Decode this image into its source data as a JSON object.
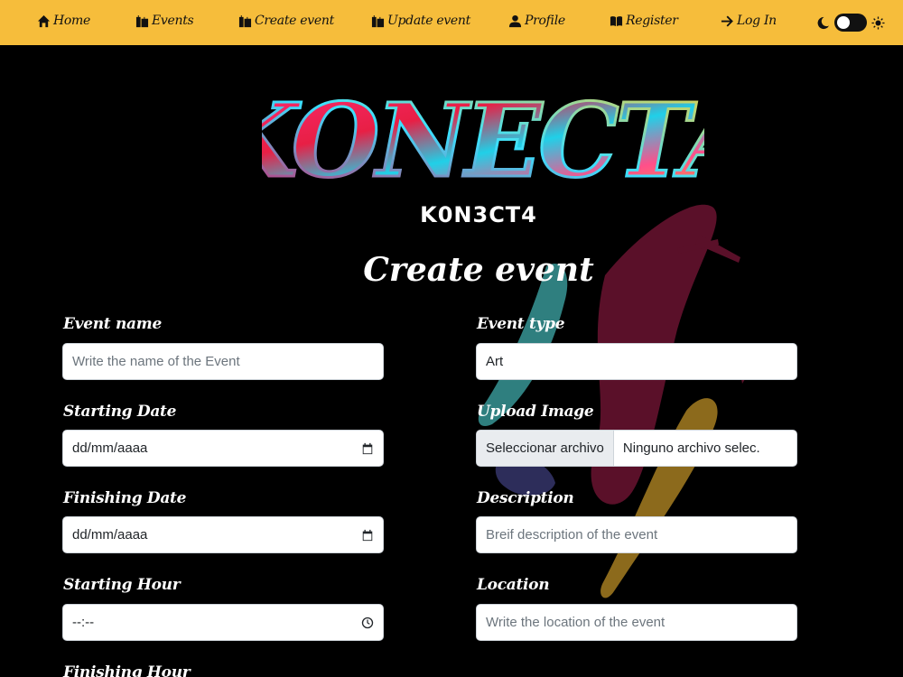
{
  "nav": {
    "home": "Home",
    "events": "Events",
    "create_event": "Create event",
    "update_event": "Update event",
    "profile": "Profile",
    "register": "Register",
    "login": "Log In"
  },
  "brand": {
    "logo_text": "KONECTA",
    "subtitle": "K0N3CT4"
  },
  "page": {
    "title": "Create event"
  },
  "form": {
    "event_name": {
      "label": "Event name",
      "placeholder": "Write the name of the Event"
    },
    "event_type": {
      "label": "Event type",
      "value": "Art"
    },
    "starting_date": {
      "label": "Starting Date",
      "value": "dd/mm/aaaa"
    },
    "upload_image": {
      "label": "Upload Image",
      "button": "Seleccionar archivo",
      "file_status": "Ninguno archivo selec."
    },
    "finishing_date": {
      "label": "Finishing Date",
      "value": "dd/mm/aaaa"
    },
    "description": {
      "label": "Description",
      "placeholder": "Breif description of the event"
    },
    "starting_hour": {
      "label": "Starting Hour",
      "value": "--:--"
    },
    "location": {
      "label": "Location",
      "placeholder": "Write the location of the event"
    },
    "finishing_hour": {
      "label": "Finishing Hour"
    }
  },
  "colors": {
    "navbar": "#f6bd3b",
    "background": "#000000",
    "splash_red": "#5a1029",
    "splash_teal": "#2f7f7f",
    "splash_gold": "#8c6a1c"
  }
}
